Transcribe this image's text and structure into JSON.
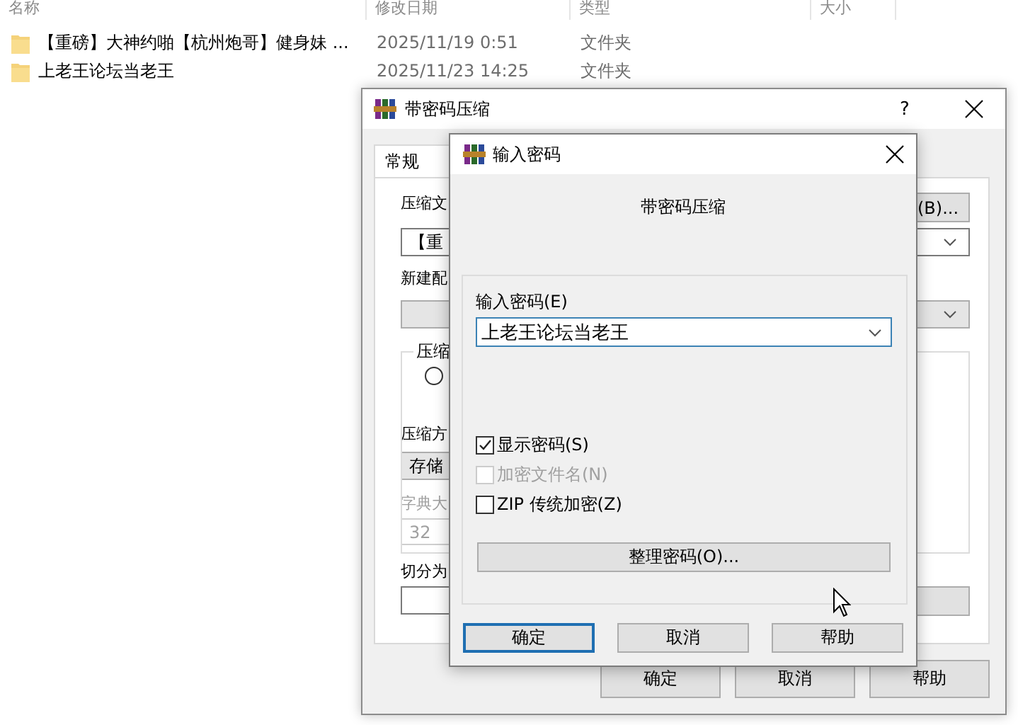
{
  "explorer": {
    "columns": [
      "名称",
      "修改日期",
      "类型",
      "大小"
    ],
    "rows": [
      {
        "name": "【重磅】大神约啪【杭州炮哥】健身妹 ...",
        "modified": "2025/11/19 0:51",
        "type": "文件夹"
      },
      {
        "name": "上老王论坛当老王",
        "modified": "2025/11/23 14:25",
        "type": "文件夹"
      }
    ]
  },
  "archive_dialog": {
    "title": "带密码压缩",
    "help_button": "?",
    "tabs": [
      {
        "label": "常规",
        "selected": true
      }
    ],
    "archive_name_label": "压缩文",
    "browse_button": "(B)...",
    "archive_name": "【重",
    "profile_label": "新建配",
    "group_label": "压缩",
    "radio": {
      "selected": false
    },
    "method_label": "压缩方",
    "method": "存储",
    "dictionary_label": "字典大",
    "dictionary_value": "32",
    "dictionary_disabled": true,
    "split_label": "切分为",
    "buttons": [
      "确定",
      "取消",
      "帮助"
    ]
  },
  "password_dialog": {
    "title": "输入密码",
    "heading": "带密码压缩",
    "password_label": "输入密码(E)",
    "password": "上老王论坛当老王",
    "options": [
      {
        "label": "显示密码(S)",
        "checked": true,
        "disabled": false
      },
      {
        "label": "加密文件名(N)",
        "checked": false,
        "disabled": true
      },
      {
        "label": "ZIP 传统加密(Z)",
        "checked": false,
        "disabled": false
      }
    ],
    "organize_button": "整理密码(O)...",
    "buttons": [
      {
        "label": "确定",
        "focused": true
      },
      {
        "label": "取消",
        "focused": false
      },
      {
        "label": "帮助",
        "focused": false
      }
    ]
  }
}
